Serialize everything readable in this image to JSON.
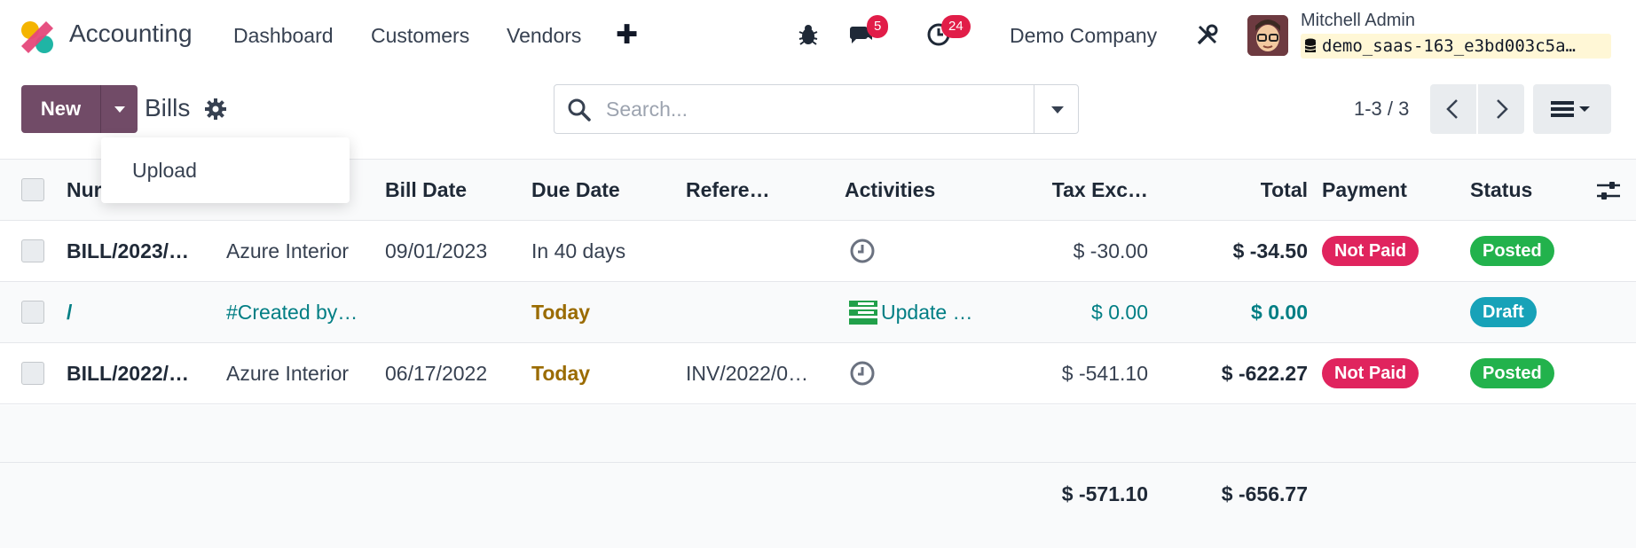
{
  "nav": {
    "app_name": "Accounting",
    "items": [
      "Dashboard",
      "Customers",
      "Vendors"
    ],
    "messages_count": "5",
    "activities_count": "24",
    "company": "Demo Company",
    "user_name": "Mitchell Admin",
    "database": "demo_saas-163_e3bd003c5a…"
  },
  "control": {
    "new_label": "New",
    "title": "Bills",
    "dropdown_item": "Upload",
    "search_placeholder": "Search...",
    "pager": "1-3 / 3"
  },
  "columns": {
    "number": "Nur",
    "bill_date": "Bill Date",
    "due_date": "Due Date",
    "reference": "Refere…",
    "activities": "Activities",
    "tax_excluded": "Tax Exc…",
    "total": "Total",
    "payment": "Payment",
    "status": "Status"
  },
  "rows": [
    {
      "number": "BILL/2023/…",
      "vendor": "Azure Interior",
      "bill_date": "09/01/2023",
      "due_date": "In 40 days",
      "reference": "",
      "activity": "clock-icon",
      "tax_excluded": "$ -30.00",
      "total": "$ -34.50",
      "payment": "Not Paid",
      "status": "Posted"
    },
    {
      "number": "/",
      "vendor": "#Created by…",
      "bill_date": "",
      "due_date": "Today",
      "reference": "",
      "activity_label": "Update …",
      "tax_excluded": "$ 0.00",
      "total": "$ 0.00",
      "payment": "",
      "status": "Draft"
    },
    {
      "number": "BILL/2022/…",
      "vendor": "Azure Interior",
      "bill_date": "06/17/2022",
      "due_date": "Today",
      "reference": "INV/2022/0…",
      "activity": "clock-icon",
      "tax_excluded": "$ -541.10",
      "total": "$ -622.27",
      "payment": "Not Paid",
      "status": "Posted"
    }
  ],
  "totals": {
    "tax_excluded": "$ -571.10",
    "total": "$ -656.77"
  },
  "colors": {
    "primary": "#714b67",
    "link": "#017e84",
    "danger": "#e0245e",
    "success": "#22b24c",
    "info": "#17a2b8",
    "warning_text": "#9a6b00",
    "badge": "#e11d48"
  }
}
